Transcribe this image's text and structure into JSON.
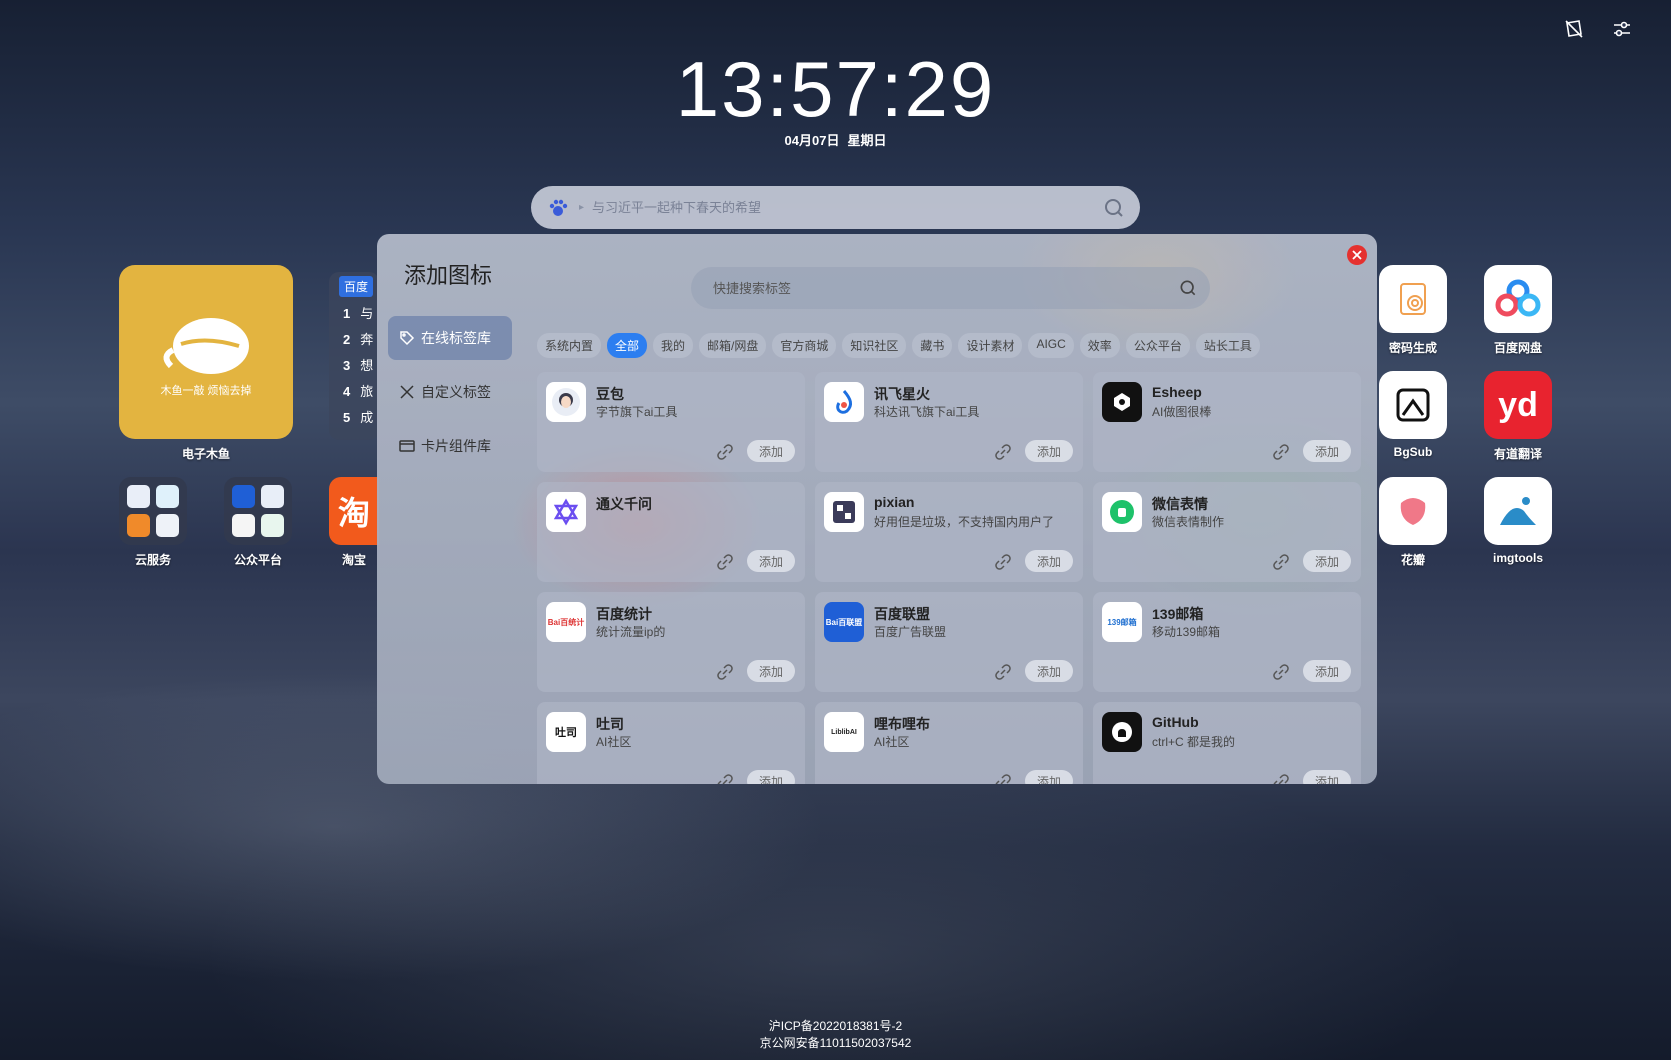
{
  "clock": {
    "time": "13:57:29",
    "date": "04月07日",
    "weekday": "星期日"
  },
  "search": {
    "placeholder": "与习近平一起种下春天的希望"
  },
  "left_apps": {
    "muyu_label": "电子木鱼",
    "muyu_text": "木鱼一敲 烦恼去掉",
    "cloud_label": "云服务",
    "gzh_label": "公众平台",
    "taobao_label": "淘宝",
    "taobao_glyph": "淘"
  },
  "hotlist": {
    "tag": "百度",
    "items": [
      {
        "no": "1",
        "text": "与"
      },
      {
        "no": "2",
        "text": "奔"
      },
      {
        "no": "3",
        "text": "想"
      },
      {
        "no": "4",
        "text": "旅"
      },
      {
        "no": "5",
        "text": "成"
      }
    ]
  },
  "right_apps": [
    {
      "label": "密码生成"
    },
    {
      "label": "百度网盘"
    },
    {
      "label": "BgSub"
    },
    {
      "label": "有道翻译"
    },
    {
      "label": "花瓣"
    },
    {
      "label": "imgtools"
    }
  ],
  "dialog": {
    "title": "添加图标",
    "search_placeholder": "快捷搜索标签",
    "sidebar": [
      "在线标签库",
      "自定义标签",
      "卡片组件库"
    ],
    "chips": [
      "系统内置",
      "全部",
      "我的",
      "邮箱/网盘",
      "官方商城",
      "知识社区",
      "藏书",
      "设计素材",
      "AIGC",
      "效率",
      "公众平台",
      "站长工具"
    ],
    "add_label": "添加",
    "cards": [
      {
        "name": "豆包",
        "desc": "字节旗下ai工具"
      },
      {
        "name": "讯飞星火",
        "desc": "科达讯飞旗下ai工具"
      },
      {
        "name": "Esheep",
        "desc": "AI做图很棒"
      },
      {
        "name": "通义千问",
        "desc": ""
      },
      {
        "name": "pixian",
        "desc": "好用但是垃圾，不支持国内用户了"
      },
      {
        "name": "微信表情",
        "desc": "微信表情制作"
      },
      {
        "name": "百度统计",
        "desc": "统计流量ip的"
      },
      {
        "name": "百度联盟",
        "desc": "百度广告联盟"
      },
      {
        "name": "139邮箱",
        "desc": "移动139邮箱"
      },
      {
        "name": "吐司",
        "desc": "AI社区"
      },
      {
        "name": "哩布哩布",
        "desc": "AI社区"
      },
      {
        "name": "GitHub",
        "desc": "ctrl+C 都是我的"
      }
    ],
    "card_icon_text": {
      "baidutongji": "Bai百统计",
      "baidulianmeng": "Bai百联盟",
      "mail139": "139邮箱",
      "tusi": "吐司",
      "liblib": "LiblibAI"
    }
  },
  "footer": {
    "icp": "沪ICP备2022018381号-2",
    "police": "京公网安备11011502037542"
  },
  "colors": {
    "accent": "#2c7ef0",
    "close": "#e5312f",
    "muyu": "#e3b440",
    "taobao": "#f25a1c",
    "youdao": "#e8232f"
  }
}
